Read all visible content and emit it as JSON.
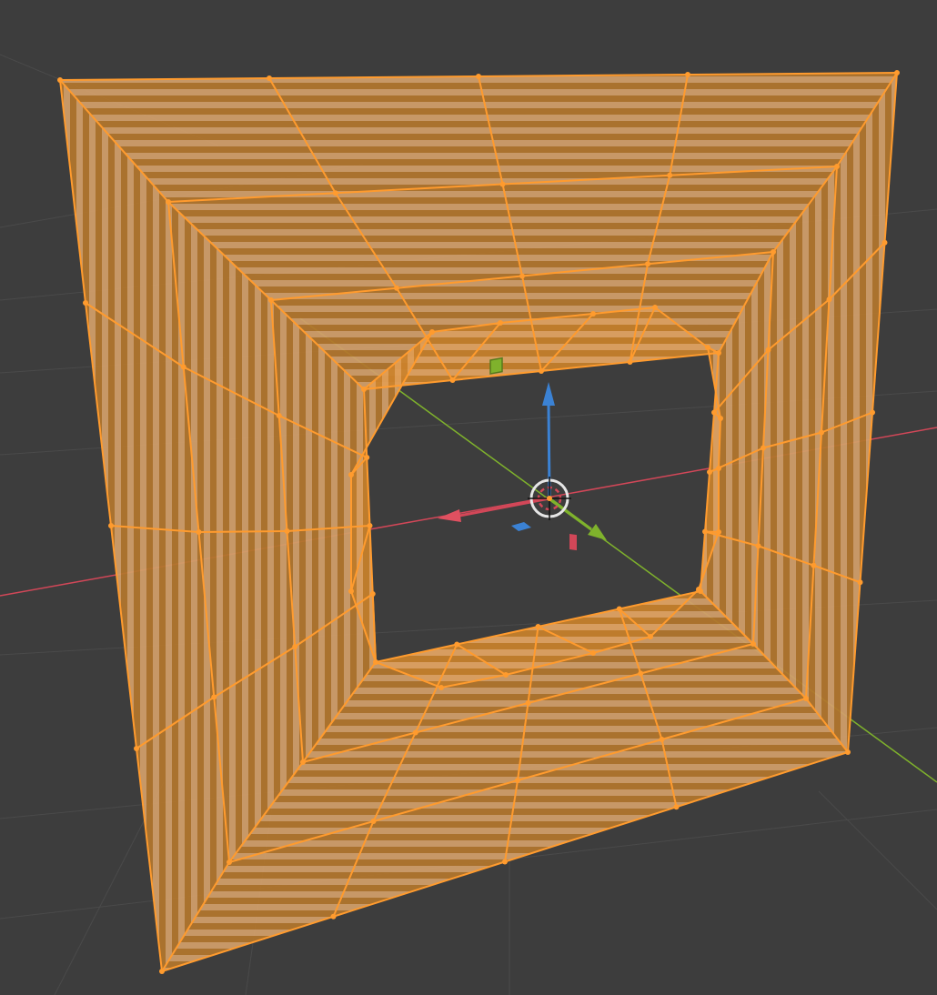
{
  "viewport": {
    "mode": "edit",
    "colors": {
      "background": "#3d3d3d",
      "grid": "#4a4a4a",
      "axis_x": "#d24758",
      "axis_y": "#7fb22c",
      "axis_z": "#3b82d4",
      "selection": "#ff9b2e",
      "face_dark": "#9a6a2c",
      "face_light": "#c8a37a"
    }
  },
  "gizmo": {
    "icon": "transform-gizmo-icon",
    "arrows": [
      "x-axis-arrow",
      "y-axis-arrow",
      "z-axis-arrow"
    ],
    "planes": [
      "xy-plane-handle",
      "xz-plane-handle",
      "yz-plane-handle"
    ],
    "center": "3d-cursor-icon"
  },
  "mesh": {
    "name": "",
    "selected": true,
    "rings": 5,
    "segments_per_side": 4,
    "texture": "checker-texture"
  }
}
